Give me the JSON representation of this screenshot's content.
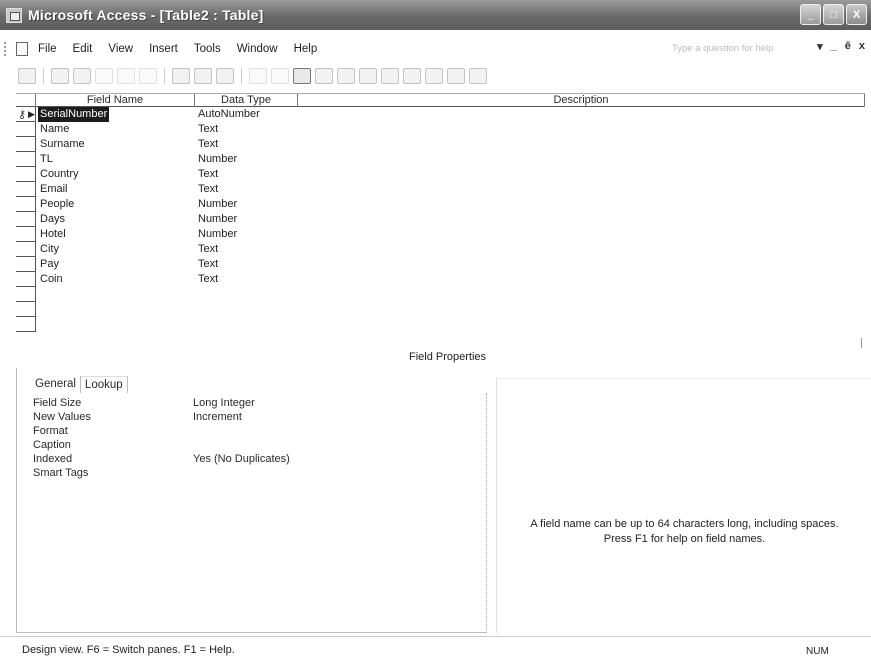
{
  "window": {
    "title": "Microsoft Access - [Table2 : Table]",
    "buttons": [
      "_",
      "□",
      "X"
    ]
  },
  "menu": {
    "items": [
      "File",
      "Edit",
      "View",
      "Insert",
      "Tools",
      "Window",
      "Help"
    ],
    "help_placeholder": "Type a question for help",
    "mdi_controls": [
      "▾",
      "_",
      "ē",
      "x"
    ]
  },
  "grid": {
    "headers": {
      "field_name": "Field Name",
      "data_type": "Data Type",
      "description": "Description"
    },
    "rows": [
      {
        "name": "SerialNumber",
        "type": "AutoNumber",
        "primary_key": true,
        "selected": true
      },
      {
        "name": "Name",
        "type": "Text"
      },
      {
        "name": "Surname",
        "type": "Text"
      },
      {
        "name": "TL",
        "type": "Number"
      },
      {
        "name": "Country",
        "type": "Text"
      },
      {
        "name": "Email",
        "type": "Text"
      },
      {
        "name": "People",
        "type": "Number"
      },
      {
        "name": "Days",
        "type": "Number"
      },
      {
        "name": "Hotel",
        "type": "Number"
      },
      {
        "name": "City",
        "type": "Text"
      },
      {
        "name": "Pay",
        "type": "Text"
      },
      {
        "name": "Coin",
        "type": "Text"
      }
    ]
  },
  "field_properties": {
    "title": "Field Properties",
    "tabs": [
      "General",
      "Lookup"
    ],
    "properties": [
      {
        "label": "Field Size",
        "value": "Long Integer"
      },
      {
        "label": "New Values",
        "value": "Increment"
      },
      {
        "label": "Format",
        "value": ""
      },
      {
        "label": "Caption",
        "value": ""
      },
      {
        "label": "Indexed",
        "value": "Yes (No Duplicates)"
      },
      {
        "label": "Smart Tags",
        "value": ""
      }
    ],
    "hint_line1": "A field name can be up to 64 characters long, including spaces.",
    "hint_line2": "Press F1 for help on field names."
  },
  "status": {
    "text": "Design view.  F6 = Switch panes.  F1 = Help.",
    "num": "NUM"
  }
}
